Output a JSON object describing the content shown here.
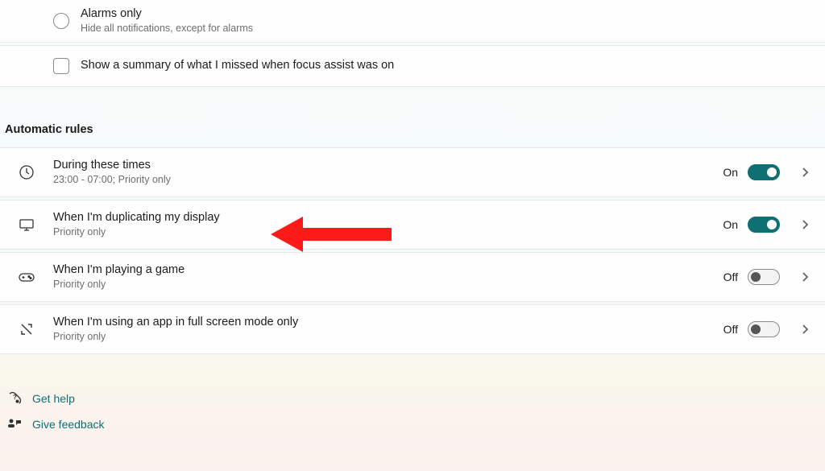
{
  "priority_section": {
    "alarms_only": {
      "title": "Alarms only",
      "subtitle": "Hide all notifications, except for alarms"
    },
    "summary_checkbox": {
      "label": "Show a summary of what I missed when focus assist was on"
    }
  },
  "automatic_rules": {
    "header": "Automatic rules",
    "items": [
      {
        "icon": "clock",
        "title": "During these times",
        "subtitle": "23:00 - 07:00; Priority only",
        "state_label": "On",
        "on": true
      },
      {
        "icon": "monitor",
        "title": "When I'm duplicating my display",
        "subtitle": "Priority only",
        "state_label": "On",
        "on": true
      },
      {
        "icon": "gamepad",
        "title": "When I'm playing a game",
        "subtitle": "Priority only",
        "state_label": "Off",
        "on": false
      },
      {
        "icon": "fullscreen",
        "title": "When I'm using an app in full screen mode only",
        "subtitle": "Priority only",
        "state_label": "Off",
        "on": false
      }
    ]
  },
  "footer": {
    "help": "Get help",
    "feedback": "Give feedback"
  },
  "colors": {
    "accent": "#0f6f73",
    "arrow": "#ff1a1a"
  }
}
